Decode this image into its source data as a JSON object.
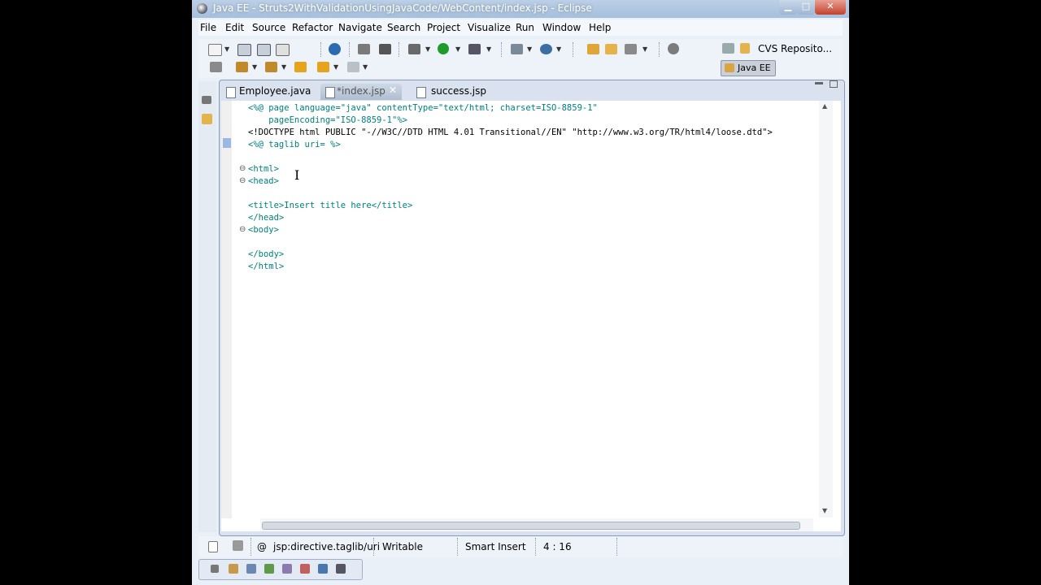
{
  "window": {
    "title": "Java EE - Struts2WithValidationUsingJavaCode/WebContent/index.jsp - Eclipse",
    "min": "▁",
    "max": "□",
    "close": "✕"
  },
  "menu": [
    "File",
    "Edit",
    "Source",
    "Refactor",
    "Navigate",
    "Search",
    "Project",
    "Visualize",
    "Run",
    "Window",
    "Help"
  ],
  "perspectives": {
    "cvs": "CVS Reposito...",
    "javaee": "Java EE"
  },
  "tabs": [
    {
      "label": "Employee.java",
      "active": false
    },
    {
      "label": "*index.jsp",
      "active": true,
      "close": "✕"
    },
    {
      "label": "success.jsp",
      "active": false
    }
  ],
  "code_lines": [
    "<%@ page language=\"java\" contentType=\"text/html; charset=ISO-8859-1\"",
    "    pageEncoding=\"ISO-8859-1\"%>",
    "<!DOCTYPE html PUBLIC \"-//W3C//DTD HTML 4.01 Transitional//EN\" \"http://www.w3.org/TR/html4/loose.dtd\">",
    "<%@ taglib uri= %>",
    "",
    "<html>",
    "<head>",
    "",
    "<title>Insert title here</title>",
    "</head>",
    "<body>",
    "",
    "</body>",
    "</html>"
  ],
  "status": {
    "context": "jsp:directive.taglib/uri",
    "writable": "Writable",
    "insert_mode": "Smart Insert",
    "position": "4 : 16"
  },
  "colors": {
    "tag": "#008080",
    "attr_value": "#2a00ff",
    "editor_bg": "#ffffff"
  },
  "icons": [
    "new-icon",
    "save-icon",
    "print-icon",
    "debug-icon",
    "run-icon",
    "search-icon",
    "back-icon",
    "forward-icon"
  ]
}
